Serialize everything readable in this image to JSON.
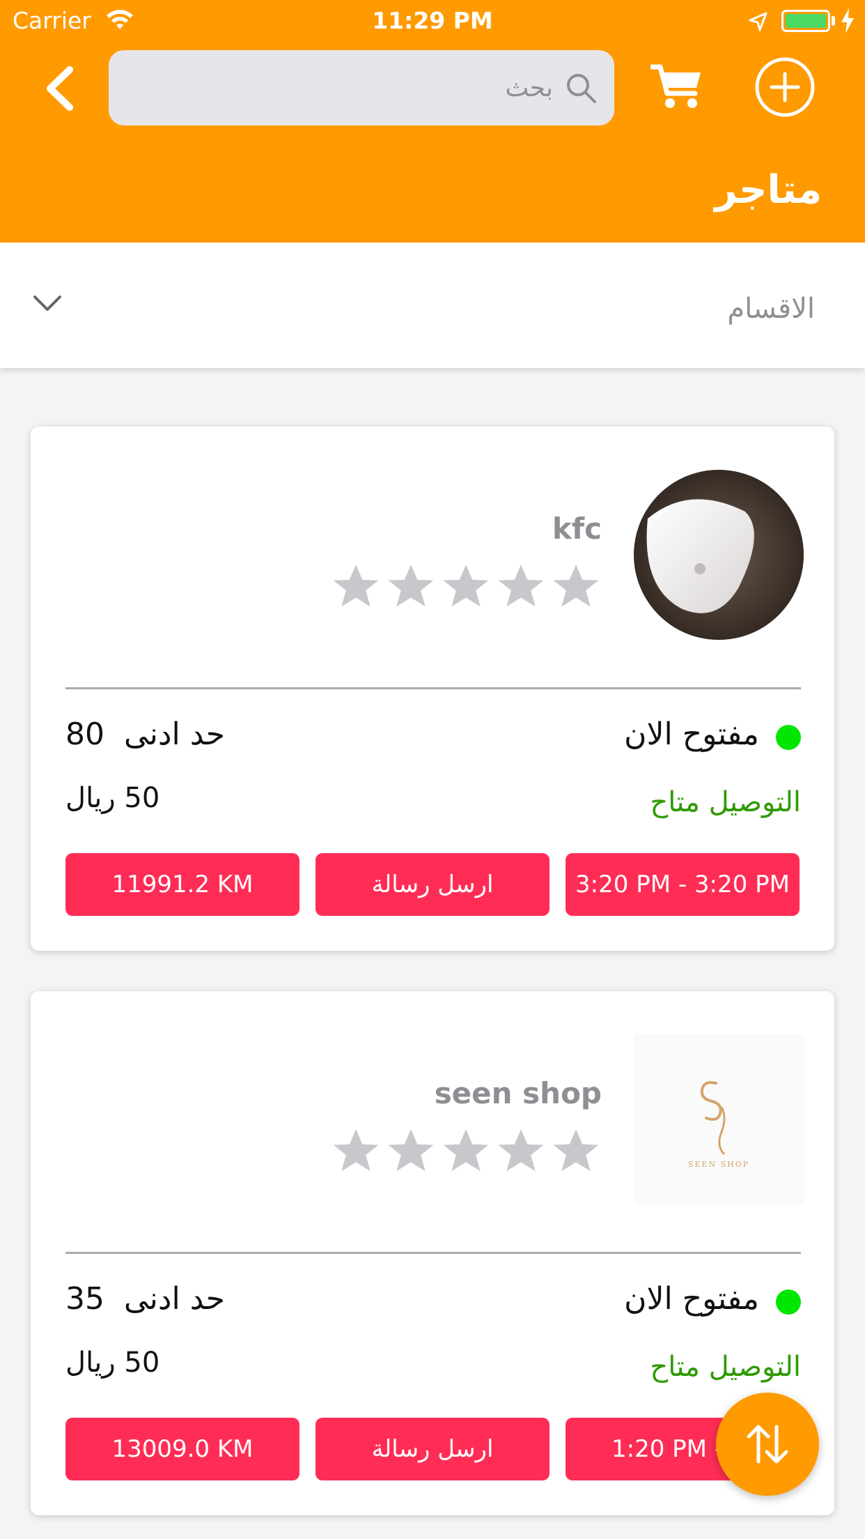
{
  "status_bar": {
    "carrier": "Carrier",
    "time": "11:29 PM",
    "battery_color": "#4cd964"
  },
  "header": {
    "search_placeholder": "بحث",
    "title": "متاجر",
    "background_color": "#ff9a00",
    "icons": [
      "back-icon",
      "search-icon",
      "cart-icon",
      "add-circle-icon"
    ]
  },
  "categories": {
    "label": "الاقسام",
    "icon": "chevron-down-icon"
  },
  "stores": [
    {
      "name": "kfc",
      "rating": 0,
      "status": "مفتوح الان",
      "min_order_value": "80",
      "min_order_label": "حد ادنى",
      "delivery": "التوصيل متاح",
      "delivery_fee": "50 ريال",
      "hours": "3:20 PM - 3:20 PM",
      "message_button": "ارسل رسالة",
      "distance": "11991.2 KM"
    },
    {
      "name": "seen shop",
      "logo_caption": "SEEN SHOP",
      "rating": 0,
      "status": "مفتوح الان",
      "min_order_value": "35",
      "min_order_label": "حد ادنى",
      "delivery": "التوصيل متاح",
      "delivery_fee": "50 ريال",
      "hours": "1:20 PM - 1:",
      "message_button": "ارسل رسالة",
      "distance": "13009.0 KM"
    }
  ],
  "colors": {
    "accent": "#ff9a00",
    "button": "#ff2d55",
    "open_dot": "#00e600",
    "delivery_text": "#2e9a00",
    "star_empty": "#c7c7cc"
  },
  "fab": {
    "icon": "sort-arrows-icon"
  }
}
